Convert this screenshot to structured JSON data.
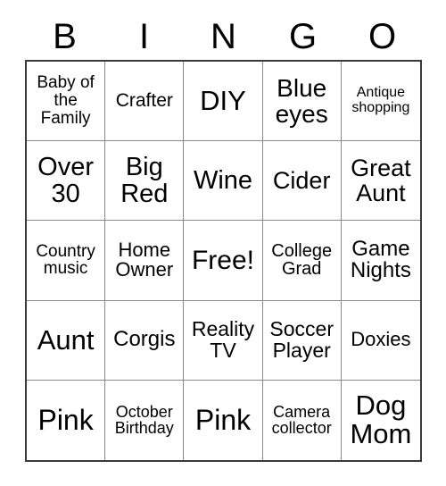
{
  "card": {
    "header": {
      "letters": [
        "B",
        "I",
        "N",
        "G",
        "O"
      ]
    },
    "grid": {
      "rows": 5,
      "columns": 5,
      "cells": [
        {
          "text": "Baby of the Family",
          "font_size": 19
        },
        {
          "text": "Crafter",
          "font_size": 21
        },
        {
          "text": "DIY",
          "font_size": 31
        },
        {
          "text": "Blue eyes",
          "font_size": 28
        },
        {
          "text": "Antique shopping",
          "font_size": 16
        },
        {
          "text": "Over 30",
          "font_size": 29
        },
        {
          "text": "Big Red",
          "font_size": 29
        },
        {
          "text": "Wine",
          "font_size": 29
        },
        {
          "text": "Cider",
          "font_size": 27
        },
        {
          "text": "Great Aunt",
          "font_size": 27
        },
        {
          "text": "Country music",
          "font_size": 19
        },
        {
          "text": "Home Owner",
          "font_size": 22
        },
        {
          "text": "Free!",
          "font_size": 30
        },
        {
          "text": "College Grad",
          "font_size": 20
        },
        {
          "text": "Game Nights",
          "font_size": 24
        },
        {
          "text": "Aunt",
          "font_size": 31
        },
        {
          "text": "Corgis",
          "font_size": 24
        },
        {
          "text": "Reality TV",
          "font_size": 23
        },
        {
          "text": "Soccer Player",
          "font_size": 23
        },
        {
          "text": "Doxies",
          "font_size": 22
        },
        {
          "text": "Pink",
          "font_size": 32
        },
        {
          "text": "October Birthday",
          "font_size": 18
        },
        {
          "text": "Pink",
          "font_size": 32
        },
        {
          "text": "Camera collector",
          "font_size": 18
        },
        {
          "text": "Dog Mom",
          "font_size": 31
        }
      ]
    },
    "colors": {
      "background": "#ffffff",
      "text": "#000000",
      "outer_border": "#3a3a3a",
      "inner_border": "#8a8a8a"
    }
  }
}
